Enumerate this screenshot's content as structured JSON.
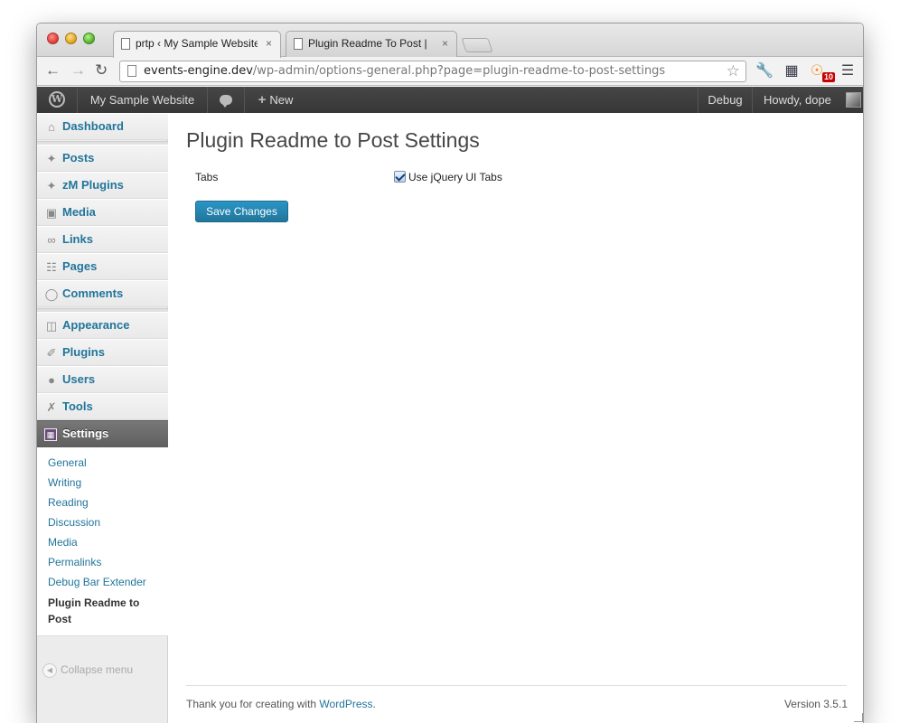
{
  "browser": {
    "tabs": [
      {
        "title": "prtp ‹ My Sample Website",
        "close": "×"
      },
      {
        "title": "Plugin Readme To Post | M",
        "close": "×"
      }
    ],
    "url_host": "events-engine.dev",
    "url_path": "/wp-admin/options-general.php?page=plugin-readme-to-post-settings",
    "rss_count": "10"
  },
  "adminbar": {
    "site_name": "My Sample Website",
    "new_label": "New",
    "debug_label": "Debug",
    "howdy_label": "Howdy, dope"
  },
  "sidebar": {
    "items": [
      {
        "label": "Dashboard",
        "icon": "dashboard-icon"
      },
      {
        "label": "Posts",
        "icon": "pin-icon"
      },
      {
        "label": "zM Plugins",
        "icon": "pin-icon"
      },
      {
        "label": "Media",
        "icon": "media-icon"
      },
      {
        "label": "Links",
        "icon": "link-icon"
      },
      {
        "label": "Pages",
        "icon": "pages-icon"
      },
      {
        "label": "Comments",
        "icon": "comment-icon"
      },
      {
        "label": "Appearance",
        "icon": "appearance-icon"
      },
      {
        "label": "Plugins",
        "icon": "plugin-icon"
      },
      {
        "label": "Users",
        "icon": "users-icon"
      },
      {
        "label": "Tools",
        "icon": "tools-icon"
      },
      {
        "label": "Settings",
        "icon": "settings-icon"
      }
    ],
    "submenu": [
      "General",
      "Writing",
      "Reading",
      "Discussion",
      "Media",
      "Permalinks",
      "Debug Bar Extender",
      "Plugin Readme to Post"
    ],
    "collapse_label": "Collapse menu"
  },
  "main": {
    "title": "Plugin Readme to Post Settings",
    "field_label": "Tabs",
    "checkbox_label": "Use jQuery UI Tabs",
    "checkbox_checked": true,
    "save_label": "Save Changes"
  },
  "footer": {
    "thanks_prefix": "Thank you for creating with ",
    "thanks_link": "WordPress",
    "thanks_suffix": ".",
    "version": "Version 3.5.1"
  },
  "colors": {
    "link": "#21759b",
    "button": "#21759b",
    "adminbar": "#464646",
    "current_menu": "#6d6d6d"
  }
}
